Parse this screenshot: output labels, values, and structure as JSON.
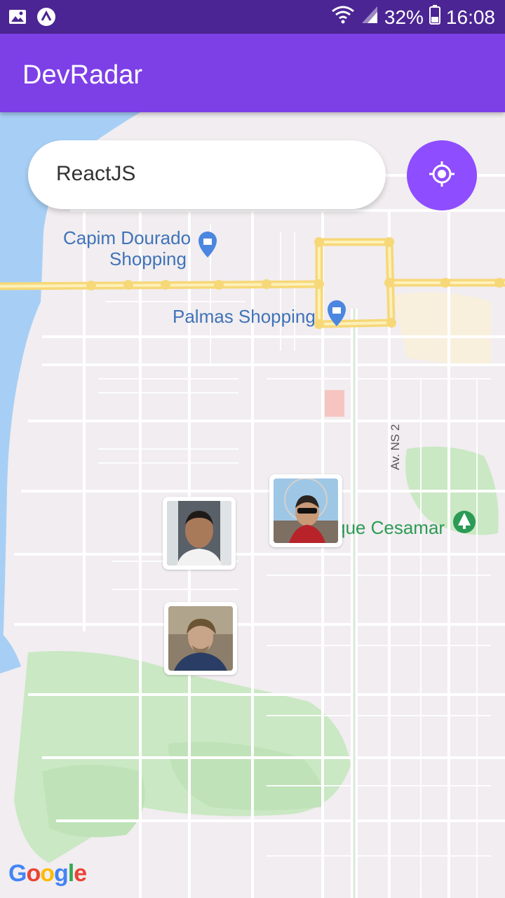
{
  "status_bar": {
    "battery": "32%",
    "time": "16:08",
    "icons": [
      "image-icon",
      "app-a-icon",
      "wifi-icon",
      "signal-icon",
      "battery-icon"
    ]
  },
  "app_bar": {
    "title": "DevRadar"
  },
  "search": {
    "value": "ReactJS"
  },
  "locate_button": {
    "icon": "my-location-icon",
    "color": "#8e4dff"
  },
  "map": {
    "places": [
      {
        "line1": "Capim Dourado",
        "line2": "Shopping"
      },
      {
        "line1": "Palmas Shopping"
      }
    ],
    "park": "que Cesamar",
    "road": "Av. NS 2",
    "attribution": "Google"
  },
  "markers": [
    {
      "name": "developer-marker-1"
    },
    {
      "name": "developer-marker-2"
    },
    {
      "name": "developer-marker-3"
    }
  ],
  "colors": {
    "status_bar": "#4b2593",
    "app_bar": "#7d40e7",
    "accent": "#8e4dff"
  }
}
